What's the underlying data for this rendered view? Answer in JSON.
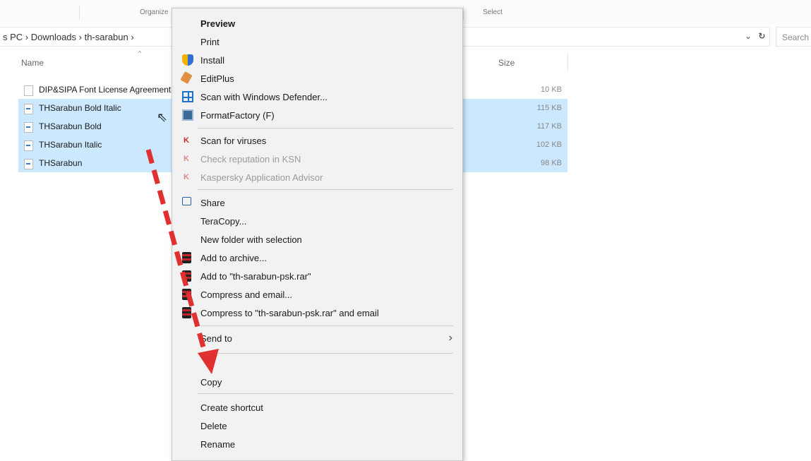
{
  "ribbon": {
    "organize": "Organize",
    "select": "Select"
  },
  "address": {
    "path": "s PC  ›  Downloads  ›  th-sarabun  ›",
    "search_placeholder": "Search"
  },
  "columns": {
    "name": "Name",
    "size": "Size"
  },
  "files": [
    {
      "name": "DIP&SIPA Font License Agreement",
      "size": "10 KB",
      "selected": false,
      "type": "document"
    },
    {
      "name": "THSarabun Bold Italic",
      "size": "115 KB",
      "selected": true,
      "type": "font"
    },
    {
      "name": "THSarabun Bold",
      "size": "117 KB",
      "selected": true,
      "type": "font"
    },
    {
      "name": "THSarabun Italic",
      "size": "102 KB",
      "selected": true,
      "type": "font"
    },
    {
      "name": "THSarabun",
      "size": "98 KB",
      "selected": true,
      "type": "font"
    }
  ],
  "context_menu": {
    "items": [
      {
        "label": "Preview",
        "bold": true
      },
      {
        "label": "Print"
      },
      {
        "label": "Install",
        "icon": "shield-icon"
      },
      {
        "label": "EditPlus",
        "icon": "editplus-icon"
      },
      {
        "label": "Scan with Windows Defender...",
        "icon": "defender-icon"
      },
      {
        "label": "FormatFactory (F)",
        "icon": "formatfactory-icon"
      },
      {
        "label": "Scan for viruses",
        "icon": "kaspersky-icon"
      },
      {
        "label": "Check reputation in KSN",
        "icon": "kaspersky-icon",
        "disabled": true
      },
      {
        "label": "Kaspersky Application Advisor",
        "icon": "kaspersky-icon",
        "disabled": true
      },
      {
        "label": "Share",
        "icon": "share-icon"
      },
      {
        "label": "TeraCopy..."
      },
      {
        "label": "New folder with selection"
      },
      {
        "label": "Add to archive...",
        "icon": "winrar-icon"
      },
      {
        "label": "Add to \"th-sarabun-psk.rar\"",
        "icon": "winrar-icon"
      },
      {
        "label": "Compress and email...",
        "icon": "winrar-icon"
      },
      {
        "label": "Compress to \"th-sarabun-psk.rar\" and email",
        "icon": "winrar-icon"
      },
      {
        "label": "Send to",
        "submenu": true
      },
      {
        "label": "Copy"
      },
      {
        "label": "Create shortcut"
      },
      {
        "label": "Delete"
      },
      {
        "label": "Rename"
      }
    ]
  },
  "colors": {
    "selection": "#cce8ff",
    "annotation_arrow": "#e03030",
    "menu_bg": "#f2f2f2"
  }
}
